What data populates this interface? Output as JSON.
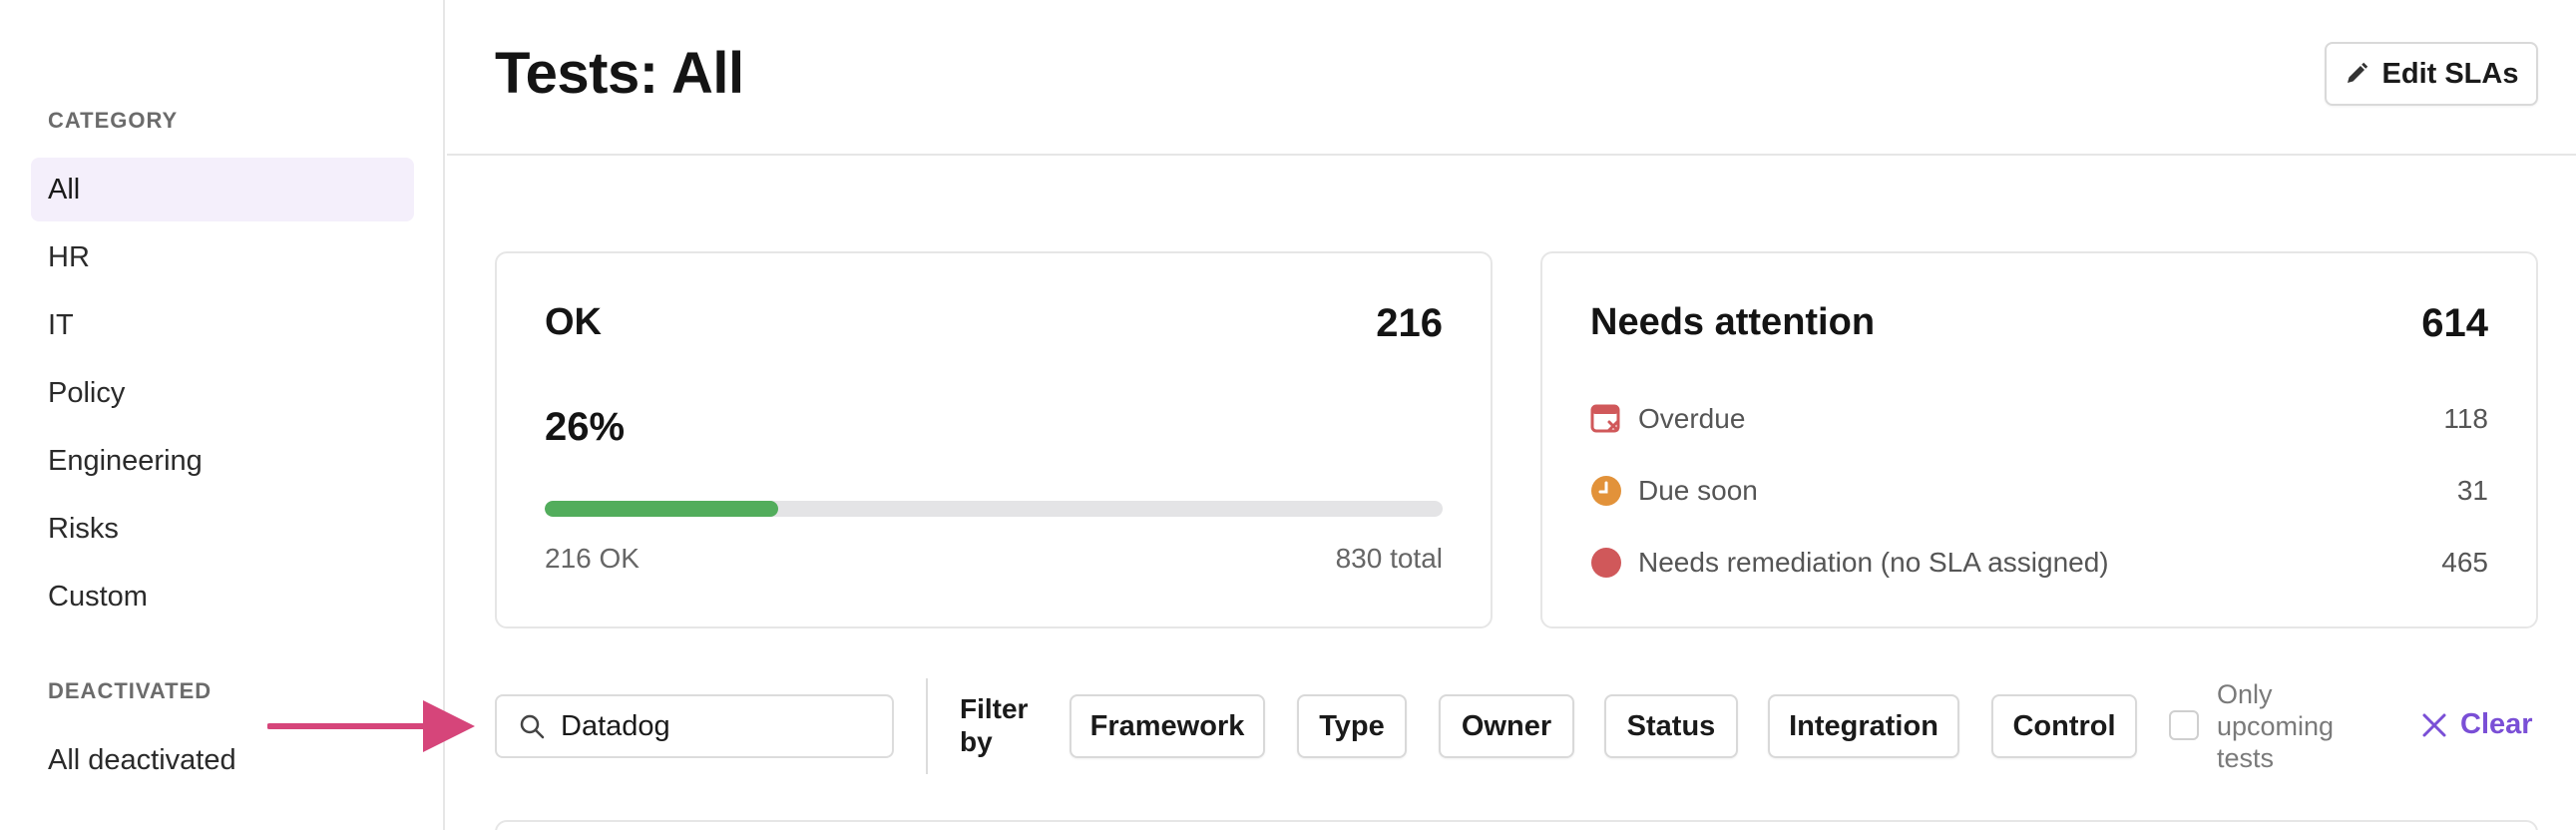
{
  "sidebar": {
    "category_title": "CATEGORY",
    "items": [
      {
        "label": "All"
      },
      {
        "label": "HR"
      },
      {
        "label": "IT"
      },
      {
        "label": "Policy"
      },
      {
        "label": "Engineering"
      },
      {
        "label": "Risks"
      },
      {
        "label": "Custom"
      }
    ],
    "deactivated_title": "DEACTIVATED",
    "deactivated_items": [
      {
        "label": "All deactivated"
      }
    ]
  },
  "header": {
    "title": "Tests: All",
    "edit_button": "Edit SLAs"
  },
  "ok_card": {
    "title": "OK",
    "count": "216",
    "percent": "26%",
    "progress_fraction": 0.26,
    "ok_label": "216 OK",
    "total_label": "830 total",
    "accent": "#52ad5c"
  },
  "attention_card": {
    "title": "Needs attention",
    "count": "614",
    "rows": [
      {
        "label": "Overdue",
        "value": "118",
        "icon": "calendar-x-icon",
        "color": "#d0585a"
      },
      {
        "label": "Due soon",
        "value": "31",
        "icon": "clock-icon",
        "color": "#e2923a"
      },
      {
        "label": "Needs remediation (no SLA assigned)",
        "value": "465",
        "icon": "red-dot-icon",
        "color": "#d0585a"
      }
    ]
  },
  "filters": {
    "search_value": "Datadog",
    "filter_by": "Filter by",
    "chips": [
      {
        "label": "Framework"
      },
      {
        "label": "Type"
      },
      {
        "label": "Owner"
      },
      {
        "label": "Status"
      },
      {
        "label": "Integration"
      },
      {
        "label": "Control"
      }
    ],
    "only_upcoming": "Only upcoming tests",
    "clear": "Clear",
    "accent": "#7a4fd6"
  }
}
